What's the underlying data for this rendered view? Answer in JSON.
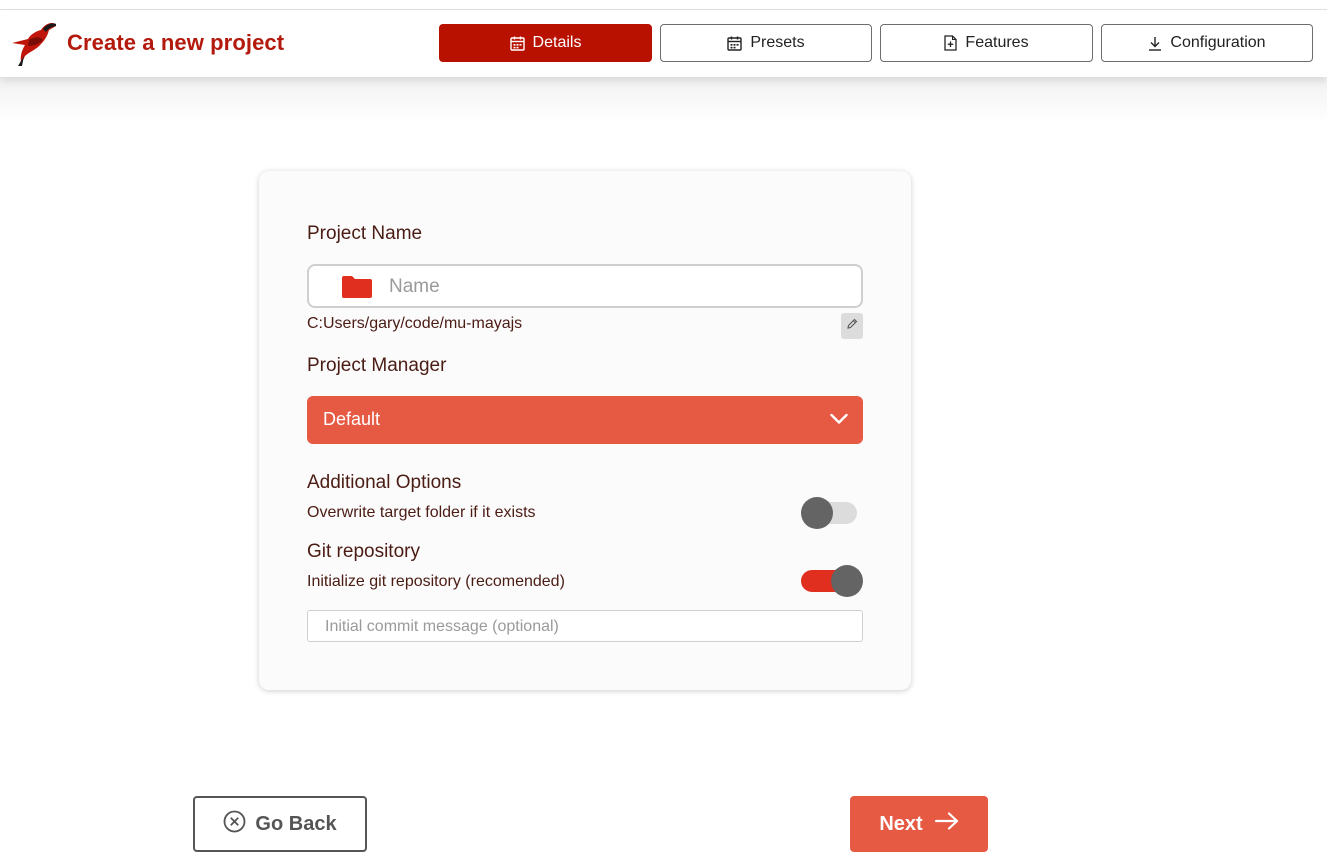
{
  "header": {
    "title": "Create a new project",
    "tabs": [
      {
        "label": "Details",
        "icon": "calendar-icon",
        "active": true
      },
      {
        "label": "Presets",
        "icon": "calendar-icon",
        "active": false
      },
      {
        "label": "Features",
        "icon": "file-plus-icon",
        "active": false
      },
      {
        "label": "Configuration",
        "icon": "download-icon",
        "active": false
      }
    ]
  },
  "form": {
    "project_name_label": "Project Name",
    "name_placeholder": "Name",
    "name_value": "",
    "path": "C:Users/gary/code/mu-mayajs",
    "project_manager_label": "Project Manager",
    "project_manager_value": "Default",
    "additional_options_label": "Additional Options",
    "overwrite_label": "Overwrite target folder if it exists",
    "overwrite_enabled": false,
    "git_label": "Git repository",
    "git_init_label": "Initialize git repository (recomended)",
    "git_init_enabled": true,
    "commit_placeholder": "Initial commit message (optional)"
  },
  "footer": {
    "back_label": "Go Back",
    "next_label": "Next"
  },
  "colors": {
    "brand": "#b31a0d",
    "active_tab": "#b81100",
    "accent": "#e65a44",
    "toggle_on": "#e02f1e",
    "toggle_off": "#dcdcdc",
    "knob": "#646464"
  }
}
